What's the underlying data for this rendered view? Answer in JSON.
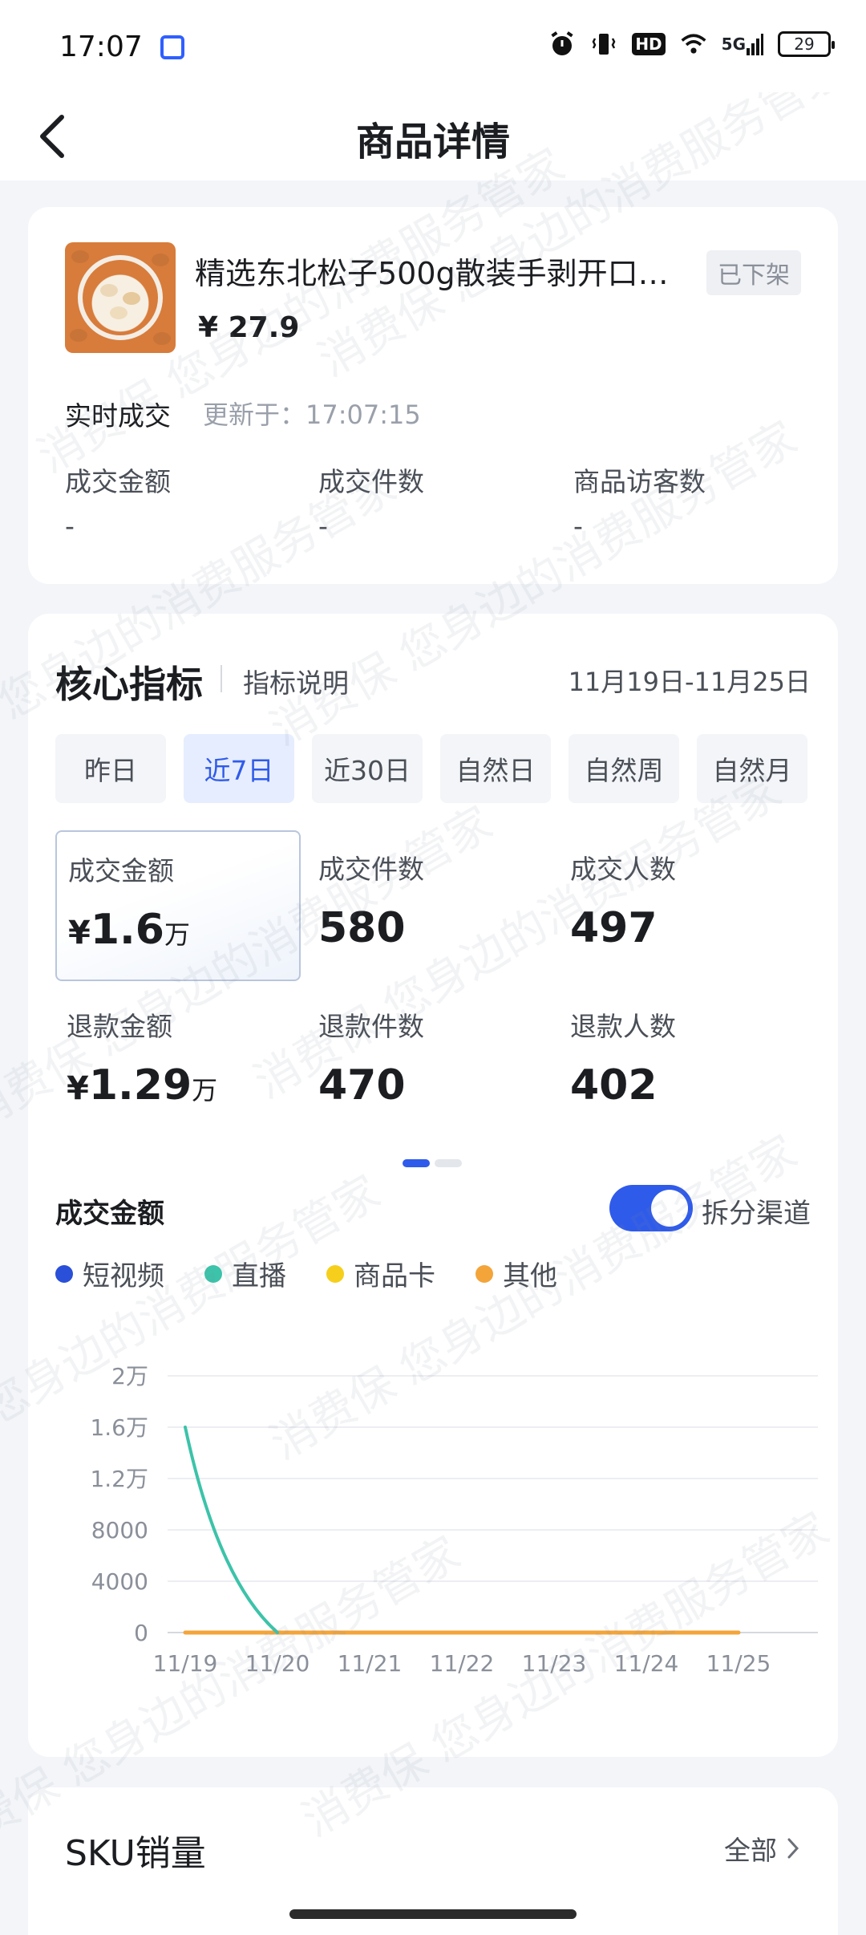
{
  "status": {
    "time": "17:07",
    "network": "5G",
    "hd": "HD",
    "battery": "29"
  },
  "nav": {
    "title": "商品详情"
  },
  "product": {
    "name": "精选东北松子500g散装手剥开口…",
    "status": "已下架",
    "price": "¥ 27.9"
  },
  "realtime": {
    "label": "实时成交",
    "update": "更新于：17:07:15",
    "stats": [
      {
        "label": "成交金额",
        "value": "-"
      },
      {
        "label": "成交件数",
        "value": "-"
      },
      {
        "label": "商品访客数",
        "value": "-"
      }
    ]
  },
  "core": {
    "title": "核心指标",
    "explain": "指标说明",
    "date_range": "11月19日-11月25日",
    "periods": [
      "昨日",
      "近7日",
      "近30日",
      "自然日",
      "自然周",
      "自然月"
    ],
    "active_period": "近7日",
    "metrics": [
      {
        "label": "成交金额",
        "currency": "¥",
        "value": "1.6",
        "unit": "万",
        "selected": true
      },
      {
        "label": "成交件数",
        "currency": "",
        "value": "580",
        "unit": ""
      },
      {
        "label": "成交人数",
        "currency": "",
        "value": "497",
        "unit": ""
      },
      {
        "label": "退款金额",
        "currency": "¥",
        "value": "1.29",
        "unit": "万"
      },
      {
        "label": "退款件数",
        "currency": "",
        "value": "470",
        "unit": ""
      },
      {
        "label": "退款人数",
        "currency": "",
        "value": "402",
        "unit": ""
      }
    ],
    "pager": {
      "pages": 2,
      "current": 1
    }
  },
  "chart_section": {
    "title": "成交金额",
    "toggle_label": "拆分渠道",
    "toggle_on": true
  },
  "chart_data": {
    "type": "line",
    "categories": [
      "11/19",
      "11/20",
      "11/21",
      "11/22",
      "11/23",
      "11/24",
      "11/25"
    ],
    "yticks": [
      "0",
      "4000",
      "8000",
      "1.2万",
      "1.6万",
      "2万"
    ],
    "ylim": [
      0,
      20000
    ],
    "grid": true,
    "legend_position": "top-left",
    "series": [
      {
        "name": "短视频",
        "color": "#2a4fd8",
        "values": [
          0,
          0,
          0,
          0,
          0,
          0,
          0
        ]
      },
      {
        "name": "直播",
        "color": "#3cc3a9",
        "values": [
          16000,
          0,
          null,
          null,
          null,
          null,
          null
        ]
      },
      {
        "name": "商品卡",
        "color": "#f5cf1c",
        "values": [
          0,
          0,
          0,
          0,
          0,
          0,
          0
        ]
      },
      {
        "name": "其他",
        "color": "#f3a53a",
        "values": [
          0,
          0,
          0,
          0,
          0,
          0,
          0
        ]
      }
    ]
  },
  "sku": {
    "title": "SKU销量",
    "all_label": "全部"
  },
  "watermark_text": "消费保 您身边的消费服务管家"
}
